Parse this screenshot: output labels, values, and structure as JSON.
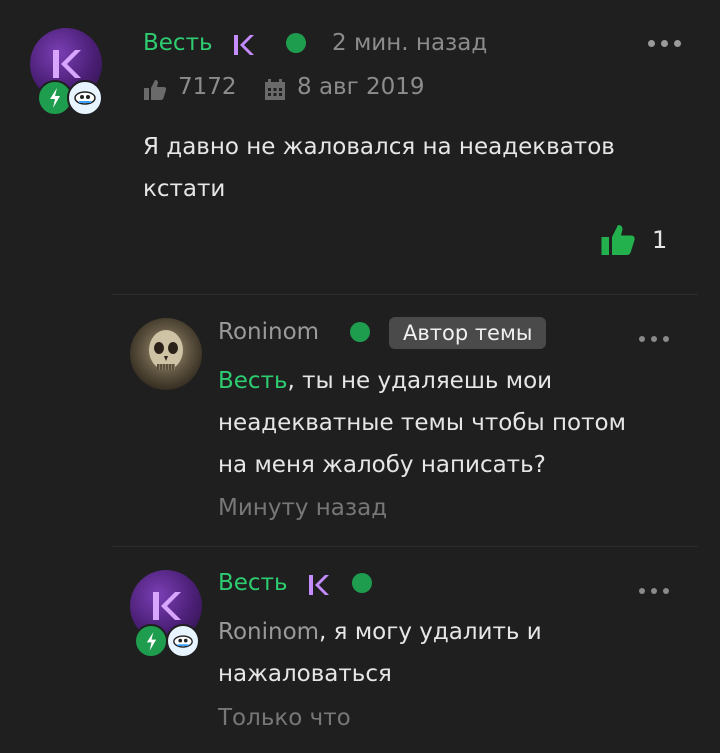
{
  "comment": {
    "author": "Весть",
    "time": "2 мин. назад",
    "likes_total": "7172",
    "date": "8 авг 2019",
    "text_line1": "Я давно не жаловался на неадекватов",
    "text_line2": "кстати",
    "like_count": "1"
  },
  "reply1": {
    "author": "Roninom",
    "tag": "Автор темы",
    "mention": "Весть",
    "text_after_mention": ", ты не удаляешь мои",
    "text_line2": "неадекватные темы чтобы потом",
    "text_line3": "на меня жалобу написать?",
    "time": "Минуту назад"
  },
  "reply2": {
    "author": "Весть",
    "mention": "Roninom",
    "text_after_mention": ", я могу удалить и",
    "text_line2": "нажаловаться",
    "time": "Только что"
  },
  "colors": {
    "accent_green": "#2ecc71",
    "online_dot": "#1f9d4f",
    "k_badge": "#b86bff"
  }
}
